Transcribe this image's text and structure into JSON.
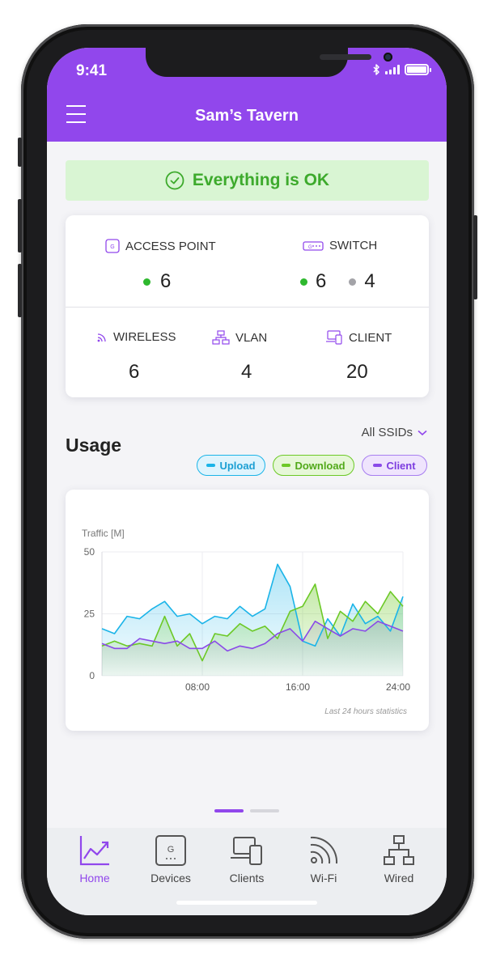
{
  "status_bar": {
    "time": "9:41"
  },
  "header": {
    "title": "Sam’s Tavern"
  },
  "banner": {
    "text": "Everything is OK"
  },
  "stats": {
    "access_point": {
      "label": "ACCESS POINT",
      "online": "6"
    },
    "switch": {
      "label": "SWITCH",
      "online": "6",
      "offline": "4"
    },
    "wireless": {
      "label": "WIRELESS",
      "value": "6"
    },
    "vlan": {
      "label": "VLAN",
      "value": "4"
    },
    "client": {
      "label": "CLIENT",
      "value": "20"
    }
  },
  "usage": {
    "title": "Usage",
    "ssid_filter": "All SSIDs",
    "legend": {
      "upload": "Upload",
      "download": "Download",
      "client": "Client"
    }
  },
  "colors": {
    "accent": "#9147ec",
    "upload": "#1bb4e8",
    "download": "#6cc926",
    "client": "#8a4ae8",
    "ok": "#3daa2c"
  },
  "chart_data": {
    "type": "area",
    "ylabel": "Traffic [M]",
    "note": "Last 24 hours statistics",
    "ylim": [
      0,
      50
    ],
    "y_ticks": [
      "50",
      "25",
      "0"
    ],
    "x_ticks": [
      "08:00",
      "16:00",
      "24:00"
    ],
    "xlim": [
      0,
      24
    ],
    "series": [
      {
        "name": "Upload",
        "x": [
          0,
          1,
          2,
          3,
          4,
          5,
          6,
          7,
          8,
          9,
          10,
          11,
          12,
          13,
          14,
          15,
          16,
          17,
          18,
          19,
          20,
          21,
          22,
          23,
          24
        ],
        "values": [
          19,
          17,
          24,
          23,
          27,
          30,
          24,
          25,
          21,
          24,
          23,
          28,
          24,
          27,
          45,
          36,
          14,
          12,
          23,
          16,
          29,
          21,
          24,
          18,
          32
        ]
      },
      {
        "name": "Download",
        "x": [
          0,
          1,
          2,
          3,
          4,
          5,
          6,
          7,
          8,
          9,
          10,
          11,
          12,
          13,
          14,
          15,
          16,
          17,
          18,
          19,
          20,
          21,
          22,
          23,
          24
        ],
        "values": [
          12,
          14,
          12,
          13,
          12,
          24,
          12,
          17,
          6,
          17,
          16,
          21,
          18,
          20,
          15,
          26,
          28,
          37,
          15,
          26,
          22,
          30,
          25,
          34,
          28
        ]
      },
      {
        "name": "Client",
        "x": [
          0,
          1,
          2,
          3,
          4,
          5,
          6,
          7,
          8,
          9,
          10,
          11,
          12,
          13,
          14,
          15,
          16,
          17,
          18,
          19,
          20,
          21,
          22,
          23,
          24
        ],
        "values": [
          13,
          11,
          11,
          15,
          14,
          13,
          14,
          11,
          11,
          14,
          10,
          12,
          11,
          13,
          17,
          19,
          14,
          22,
          19,
          16,
          19,
          18,
          22,
          20,
          18
        ]
      }
    ]
  },
  "pager": {
    "active_index": 0,
    "count": 2
  },
  "tabs": [
    {
      "label": "Home",
      "icon": "chart-line-icon",
      "active": true
    },
    {
      "label": "Devices",
      "icon": "device-g-icon",
      "active": false
    },
    {
      "label": "Clients",
      "icon": "laptop-phone-icon",
      "active": false
    },
    {
      "label": "Wi-Fi",
      "icon": "wifi-icon",
      "active": false
    },
    {
      "label": "Wired",
      "icon": "network-icon",
      "active": false
    }
  ]
}
